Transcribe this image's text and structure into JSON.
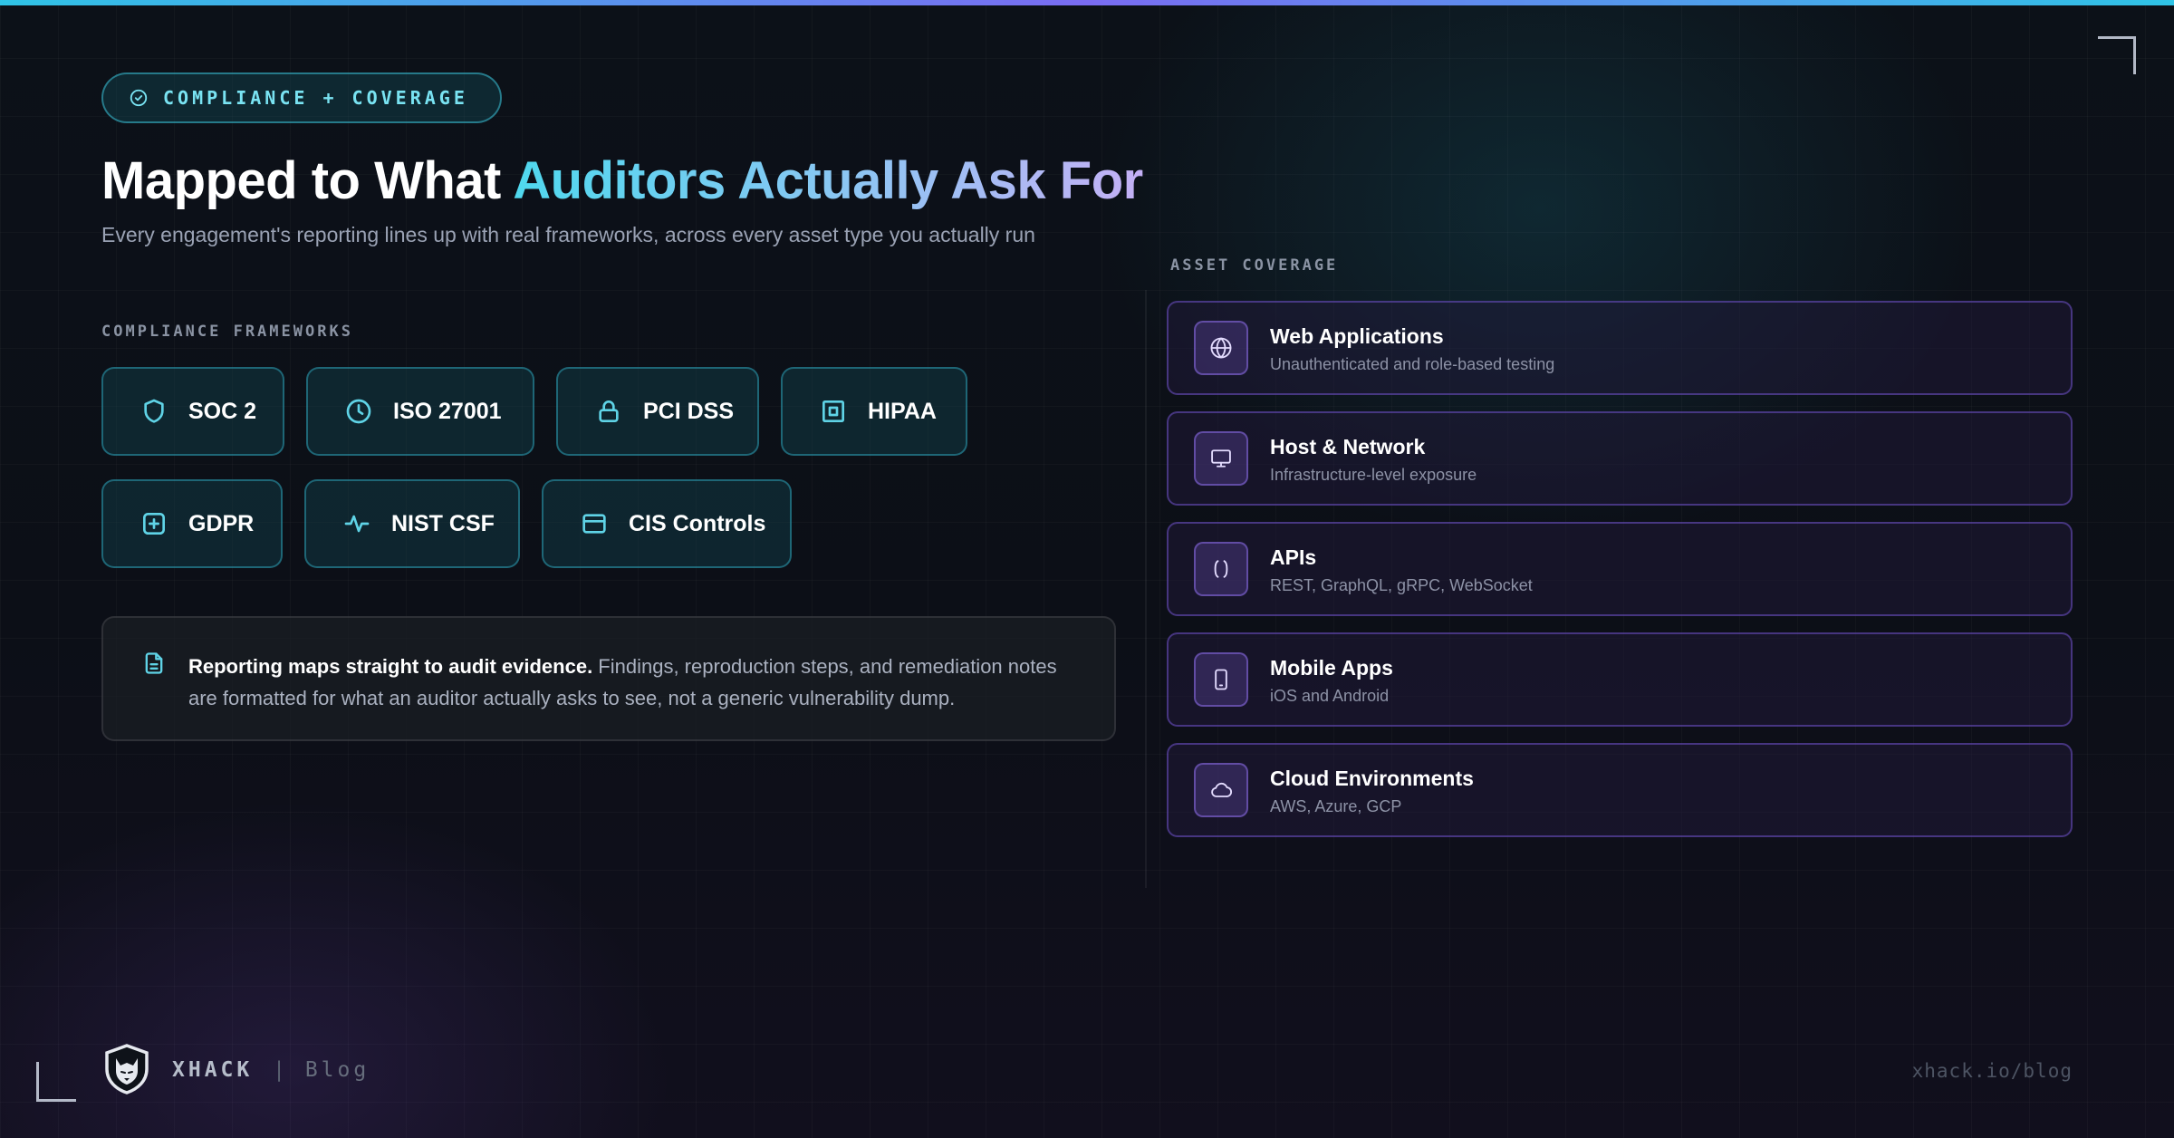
{
  "badge": {
    "label": "COMPLIANCE + COVERAGE",
    "icon": "check-circle-icon"
  },
  "heading": {
    "prefix": "Mapped to What ",
    "accent": "Auditors Actually Ask For"
  },
  "subheading": "Every engagement's reporting lines up with real frameworks, across every asset type you actually run",
  "frameworks": {
    "label": "COMPLIANCE FRAMEWORKS",
    "items": [
      {
        "label": "SOC 2",
        "icon": "shield-icon"
      },
      {
        "label": "ISO 27001",
        "icon": "clock-icon"
      },
      {
        "label": "PCI DSS",
        "icon": "lock-icon"
      },
      {
        "label": "HIPAA",
        "icon": "square-target-icon"
      },
      {
        "label": "GDPR",
        "icon": "plus-square-icon"
      },
      {
        "label": "NIST CSF",
        "icon": "activity-icon"
      },
      {
        "label": "CIS Controls",
        "icon": "window-icon"
      }
    ]
  },
  "note": {
    "bold": "Reporting maps straight to audit evidence.",
    "text": " Findings, reproduction steps, and remediation notes are formatted for what an auditor actually asks to see, not a generic vulnerability dump.",
    "icon": "document-icon"
  },
  "assets": {
    "label": "ASSET COVERAGE",
    "items": [
      {
        "title": "Web Applications",
        "desc": "Unauthenticated and role-based testing",
        "icon": "globe-icon"
      },
      {
        "title": "Host & Network",
        "desc": "Infrastructure-level exposure",
        "icon": "monitor-icon"
      },
      {
        "title": "APIs",
        "desc": "REST, GraphQL, gRPC, WebSocket",
        "icon": "braces-icon"
      },
      {
        "title": "Mobile Apps",
        "desc": "iOS and Android",
        "icon": "smartphone-icon"
      },
      {
        "title": "Cloud Environments",
        "desc": "AWS, Azure, GCP",
        "icon": "cloud-icon"
      }
    ]
  },
  "footer": {
    "brand": "XHACK",
    "separator": "|",
    "section": "Blog",
    "url": "xhack.io/blog",
    "logo_icon": "wolf-shield-icon"
  },
  "colors": {
    "accent_cyan": "#4fd8ee",
    "accent_purple": "#c4b0f5",
    "chip_border": "#2ea8be",
    "asset_border": "#6e52c8",
    "background": "#0c1118"
  }
}
